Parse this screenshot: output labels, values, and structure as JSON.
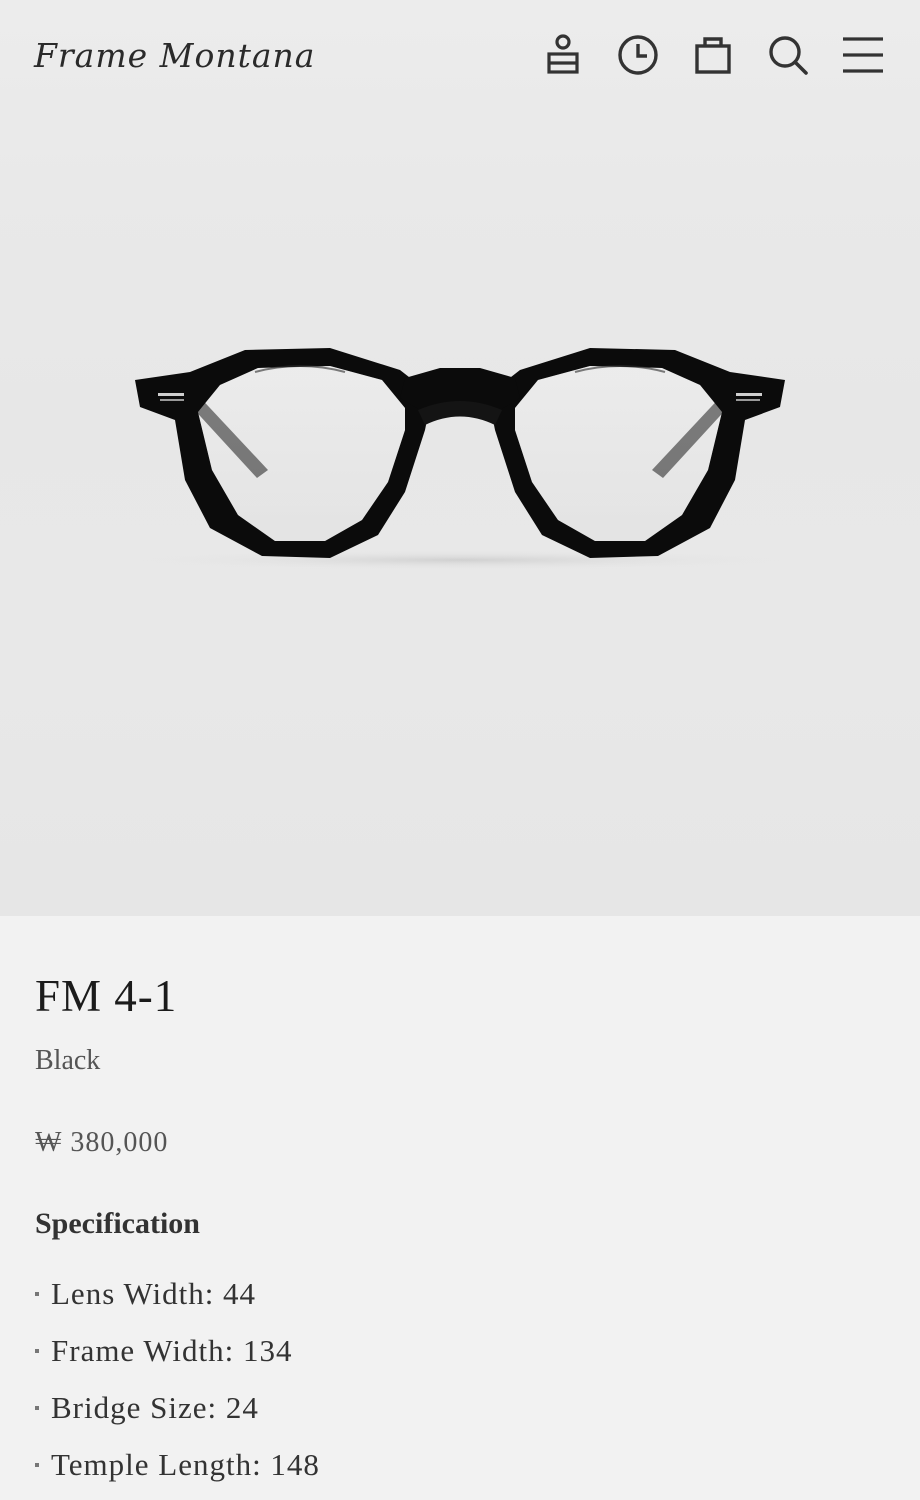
{
  "brand": {
    "name": "Frame Montana"
  },
  "header": {
    "icons": [
      {
        "name": "account-icon",
        "label": "Account"
      },
      {
        "name": "recently-viewed-icon",
        "label": "Recently viewed"
      },
      {
        "name": "cart-icon",
        "label": "Cart"
      },
      {
        "name": "search-icon",
        "label": "Search"
      },
      {
        "name": "menu-icon",
        "label": "Menu"
      }
    ]
  },
  "product": {
    "title": "FM 4-1",
    "color": "Black",
    "price": "₩ 380,000",
    "spec_heading": "Specification",
    "specs": [
      "Lens Width: 44",
      "Frame Width: 134",
      "Bridge Size: 24",
      "Temple Length: 148"
    ],
    "frame_color": "#0b0b0b"
  },
  "colors": {
    "page_background": "#f2f2f2",
    "hero_background": "#e8e8e8",
    "icon_color": "#333333",
    "text_primary": "#1b1b1b",
    "text_secondary": "#555555"
  }
}
